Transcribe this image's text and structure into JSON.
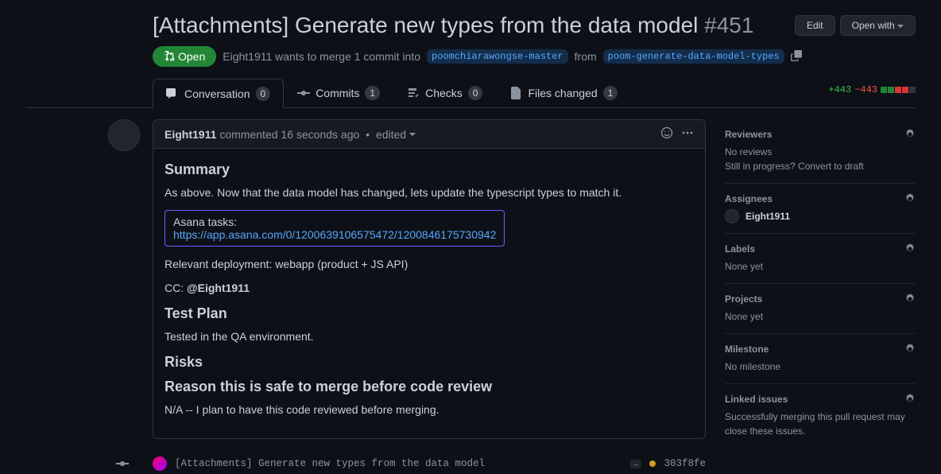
{
  "header": {
    "title": "[Attachments] Generate new types from the data model",
    "pr_number": "#451",
    "edit_btn": "Edit",
    "open_with_btn": "Open with"
  },
  "meta": {
    "state": "Open",
    "author": "Eight1911",
    "action_text": "wants to merge 1 commit into",
    "base_branch": "poomchiarawongse-master",
    "from_text": "from",
    "head_branch": "poom-generate-data-model-types"
  },
  "tabs": {
    "conversation": {
      "label": "Conversation",
      "count": "0"
    },
    "commits": {
      "label": "Commits",
      "count": "1"
    },
    "checks": {
      "label": "Checks",
      "count": "0"
    },
    "files": {
      "label": "Files changed",
      "count": "1"
    }
  },
  "diffstat": {
    "add": "+443",
    "del": "−443"
  },
  "comment": {
    "author": "Eight1911",
    "time": "commented 16 seconds ago",
    "edited": "edited",
    "summary_h": "Summary",
    "summary_p": "As above. Now that the data model has changed, lets update the typescript types to match it.",
    "asana_label": "Asana tasks:",
    "asana_link": "https://app.asana.com/0/1200639106575472/1200846175730942",
    "deploy": "Relevant deployment: webapp (product + JS API)",
    "cc_prefix": "CC: ",
    "cc_mention": "@Eight1911",
    "testplan_h": "Test Plan",
    "testplan_p": "Tested in the QA environment.",
    "risks_h": "Risks",
    "reason_h": "Reason this is safe to merge before code review",
    "reason_p": "N/A -- I plan to have this code reviewed before merging."
  },
  "commit": {
    "msg": "[Attachments] Generate new types from the data model",
    "sha": "303f8fe"
  },
  "sidebar": {
    "reviewers": {
      "title": "Reviewers",
      "text": "No reviews",
      "convert": "Still in progress? Convert to draft"
    },
    "assignees": {
      "title": "Assignees",
      "name": "Eight1911"
    },
    "labels": {
      "title": "Labels",
      "text": "None yet"
    },
    "projects": {
      "title": "Projects",
      "text": "None yet"
    },
    "milestone": {
      "title": "Milestone",
      "text": "No milestone"
    },
    "linked": {
      "title": "Linked issues",
      "text": "Successfully merging this pull request may close these issues."
    }
  }
}
